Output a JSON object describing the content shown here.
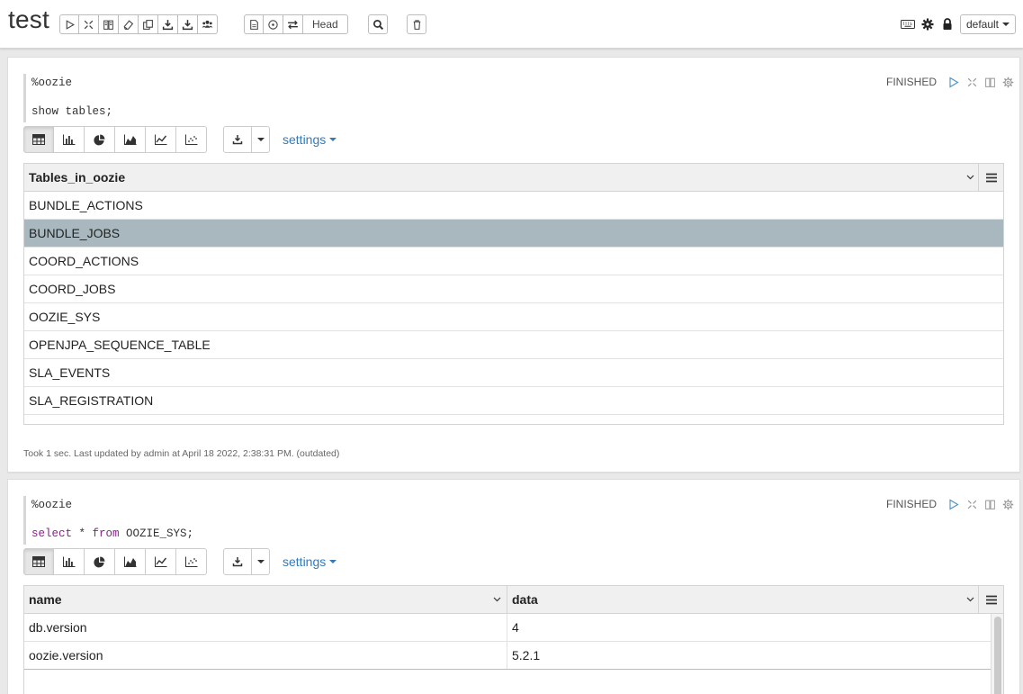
{
  "notebook": {
    "title": "test",
    "head_label": "Head",
    "default_label": "default"
  },
  "toolbar": {
    "icons": [
      "run-all-icon",
      "toggle-code-icon",
      "toggle-output-icon",
      "clear-output-icon",
      "clone-icon",
      "export-icon",
      "export-ipynb-icon",
      "permissions-icon"
    ],
    "version_icons": [
      "commit-icon",
      "revisions-icon",
      "compare-icon"
    ]
  },
  "paragraphs": [
    {
      "interpreter": "%oozie",
      "code_plain": "show tables;",
      "status": "FINISHED",
      "settings_label": "settings",
      "table": {
        "columns": [
          "Tables_in_oozie"
        ],
        "rows": [
          [
            "BUNDLE_ACTIONS"
          ],
          [
            "BUNDLE_JOBS"
          ],
          [
            "COORD_ACTIONS"
          ],
          [
            "COORD_JOBS"
          ],
          [
            "OOZIE_SYS"
          ],
          [
            "OPENJPA_SEQUENCE_TABLE"
          ],
          [
            "SLA_EVENTS"
          ],
          [
            "SLA_REGISTRATION"
          ]
        ],
        "highlighted_row": 1
      },
      "footer": "Took 1 sec. Last updated by admin at April 18 2022, 2:38:31 PM. (outdated)"
    },
    {
      "interpreter": "%oozie",
      "code_kw1": "select",
      "code_mid": " * ",
      "code_kw2": "from",
      "code_rest": " OOZIE_SYS;",
      "status": "FINISHED",
      "settings_label": "settings",
      "table": {
        "columns": [
          "name",
          "data"
        ],
        "rows": [
          [
            "db.version",
            "4"
          ],
          [
            "oozie.version",
            "5.2.1"
          ]
        ]
      }
    }
  ],
  "colors": {
    "highlight_row": "#a9b8bf",
    "keyword": "#8a1f8f",
    "link": "#337ab7"
  }
}
